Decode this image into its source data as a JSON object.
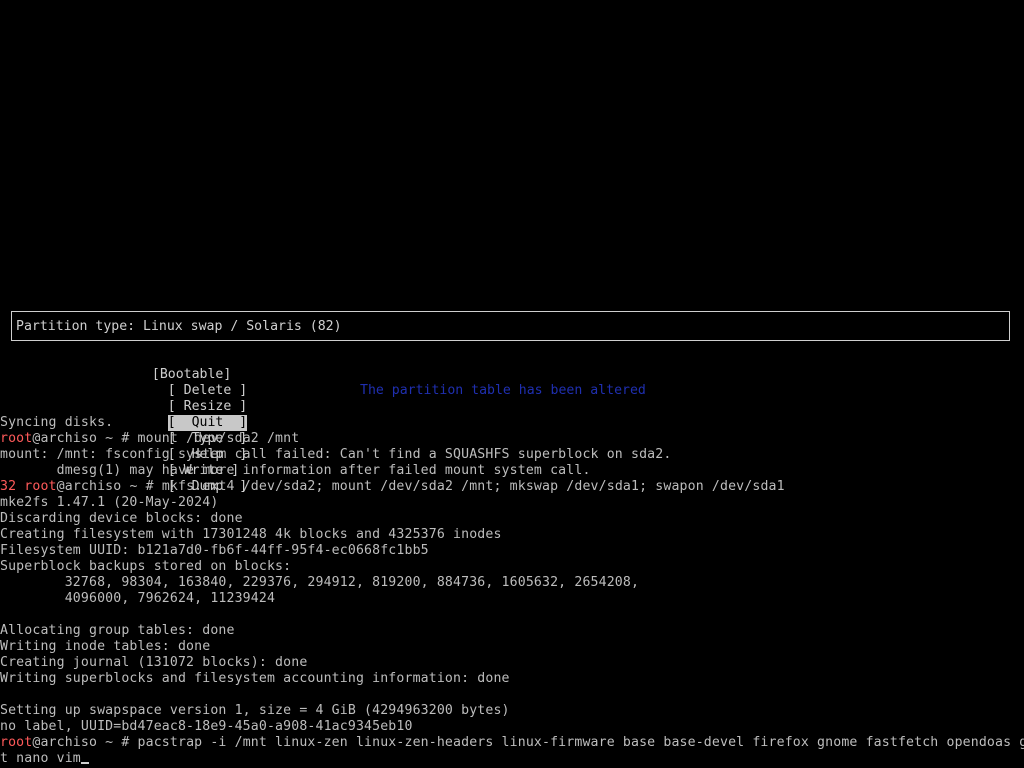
{
  "cfdisk": {
    "partition_type_line": "Partition type: Linux swap / Solaris (82)",
    "menu": [
      {
        "label": "[Bootable]",
        "selected": false
      },
      {
        "label": "[ Delete ]",
        "selected": false
      },
      {
        "label": "[ Resize ]",
        "selected": false
      },
      {
        "label": "[  Quit  ]",
        "selected": true
      },
      {
        "label": "[  Type  ]",
        "selected": false
      },
      {
        "label": "[  Help  ]",
        "selected": false
      },
      {
        "label": "[ Write ]",
        "selected": false
      },
      {
        "label": "[  Dump  ]",
        "selected": false
      }
    ],
    "status_message": "The partition table has been altered"
  },
  "terminal": {
    "l1": "Syncing disks.",
    "prompt_user": "root",
    "prompt_host": "@archiso ~ # ",
    "cmd1": "mount /dev/sda2 /mnt",
    "l3": "mount: /mnt: fsconfig system call failed: Can't find a SQUASHFS superblock on sda2.",
    "l4": "       dmesg(1) may have more information after failed mount system call.",
    "exit_code": "32 ",
    "cmd2": "mkfs.ext4 /dev/sda2; mount /dev/sda2 /mnt; mkswap /dev/sda1; swapon /dev/sda1",
    "l6": "mke2fs 1.47.1 (20-May-2024)",
    "l7": "Discarding device blocks: done",
    "l8": "Creating filesystem with 17301248 4k blocks and 4325376 inodes",
    "l9": "Filesystem UUID: b121a7d0-fb6f-44ff-95f4-ec0668fc1bb5",
    "l10": "Superblock backups stored on blocks:",
    "l11": "        32768, 98304, 163840, 229376, 294912, 819200, 884736, 1605632, 2654208,",
    "l12": "        4096000, 7962624, 11239424",
    "l14": "Allocating group tables: done",
    "l15": "Writing inode tables: done",
    "l16": "Creating journal (131072 blocks): done",
    "l17": "Writing superblocks and filesystem accounting information: done",
    "l19": "Setting up swapspace version 1, size = 4 GiB (4294963200 bytes)",
    "l20": "no label, UUID=bd47eac8-18e9-45a0-a908-41ac9345eb10",
    "cmd3": "pacstrap -i /mnt linux-zen linux-zen-headers linux-firmware base base-devel firefox gnome fastfetch opendoas gi",
    "l22": "t nano vim"
  }
}
